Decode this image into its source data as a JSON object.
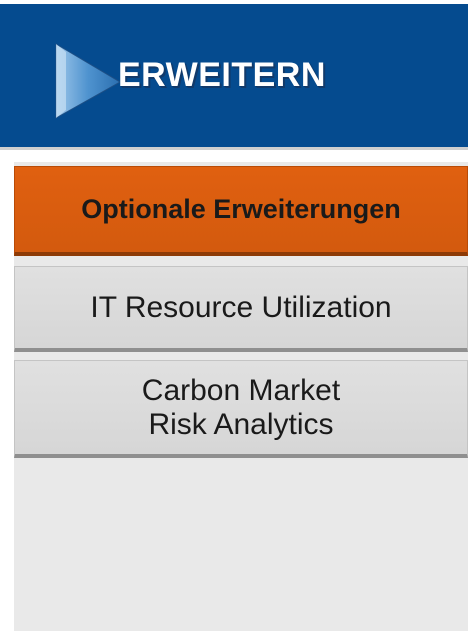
{
  "header": {
    "title": "ERWEITERN",
    "icon": "play-arrow-icon",
    "background_color": "#054b8f"
  },
  "menu": {
    "items": [
      {
        "label": "Optionale Erweiterungen",
        "active": true,
        "color": "#d85c0f"
      },
      {
        "label": "IT Resource Utilization",
        "active": false
      },
      {
        "label": "Carbon Market",
        "label_line2": "Risk Analytics",
        "active": false
      }
    ]
  }
}
